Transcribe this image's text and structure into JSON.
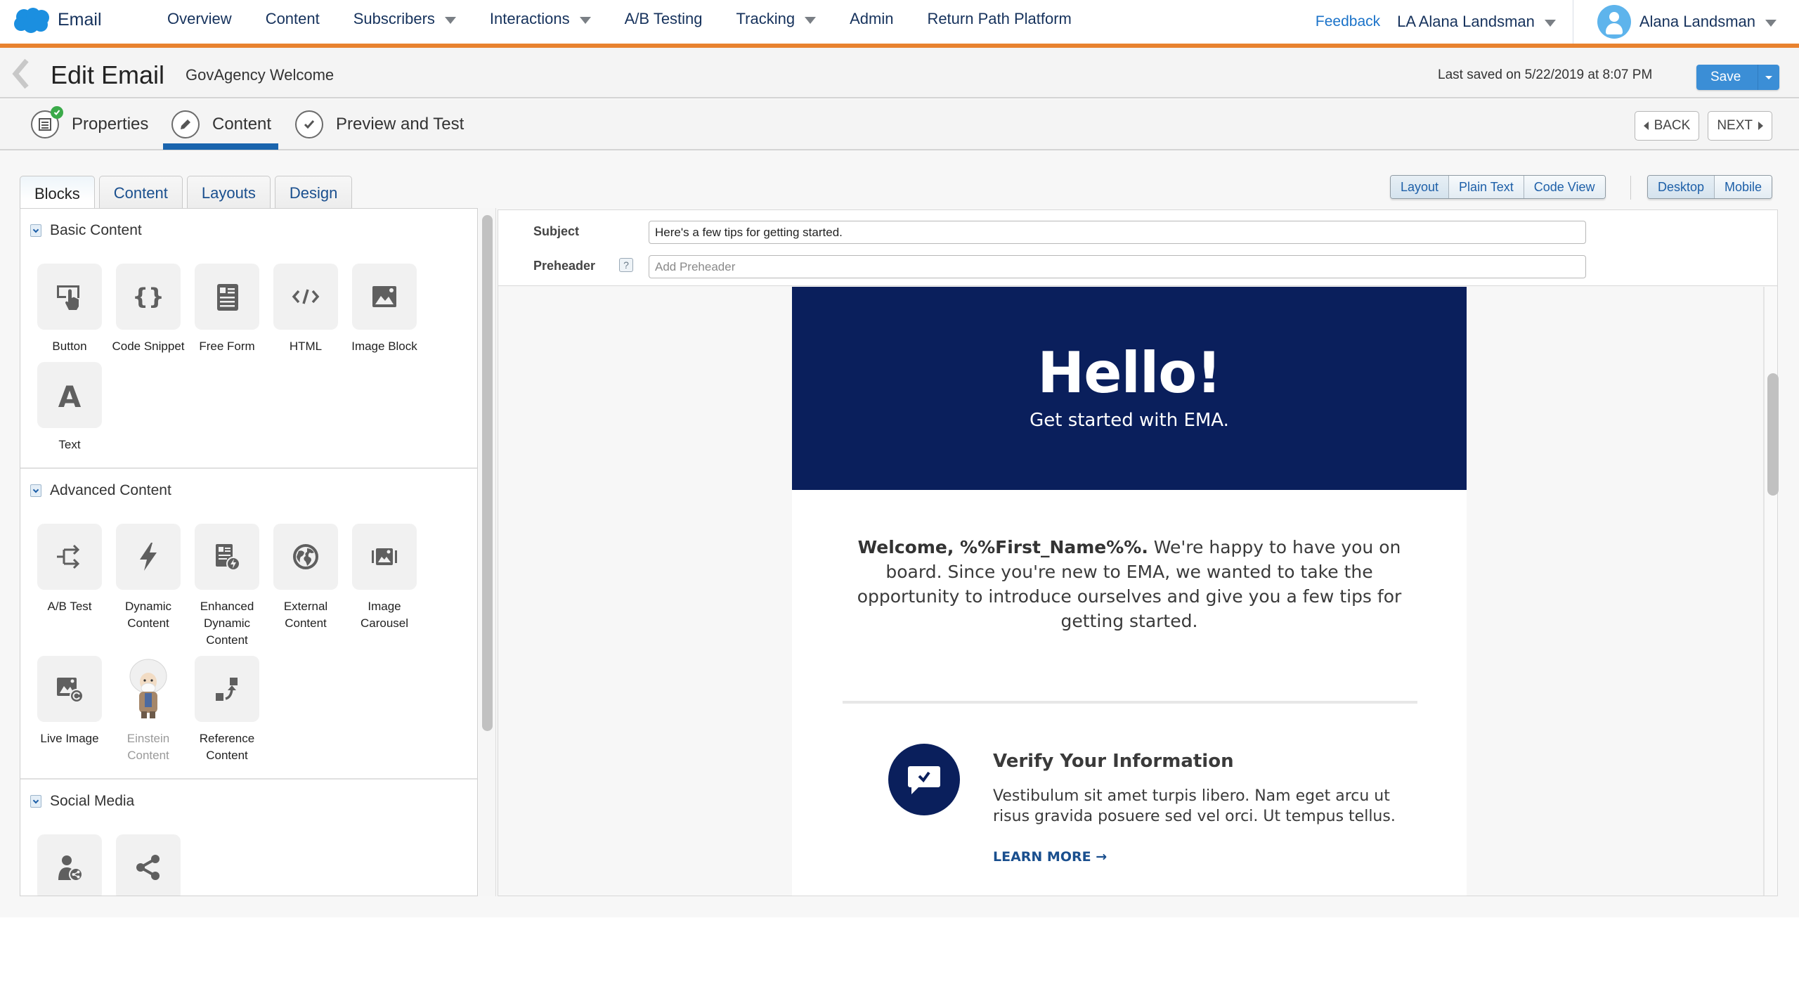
{
  "topnav": {
    "app_name": "Email",
    "links": [
      {
        "label": "Overview",
        "has_caret": false
      },
      {
        "label": "Content",
        "has_caret": false
      },
      {
        "label": "Subscribers",
        "has_caret": true
      },
      {
        "label": "Interactions",
        "has_caret": true
      },
      {
        "label": "A/B Testing",
        "has_caret": false
      },
      {
        "label": "Tracking",
        "has_caret": true
      },
      {
        "label": "Admin",
        "has_caret": false
      },
      {
        "label": "Return Path Platform",
        "has_caret": false
      }
    ],
    "feedback": "Feedback",
    "account_switcher": "LA Alana Landsman",
    "user_name": "Alana Landsman",
    "accent_color": "#e8822f",
    "logo_color": "#1b8fe0"
  },
  "header": {
    "title": "Edit Email",
    "email_name": "GovAgency Welcome",
    "last_saved": "Last saved on 5/22/2019 at 8:07 PM",
    "save_label": "Save"
  },
  "steps": {
    "items": [
      {
        "label": "Properties",
        "icon": "properties-icon",
        "completed": true
      },
      {
        "label": "Content",
        "icon": "pencil-icon",
        "active": true
      },
      {
        "label": "Preview and Test",
        "icon": "checkmark-icon"
      }
    ],
    "back_label": "BACK",
    "next_label": "NEXT"
  },
  "panel_tabs": [
    {
      "label": "Blocks",
      "active": true
    },
    {
      "label": "Content"
    },
    {
      "label": "Layouts"
    },
    {
      "label": "Design"
    }
  ],
  "sections": [
    {
      "title": "Basic Content",
      "blocks": [
        {
          "label": "Button",
          "icon": "button-icon"
        },
        {
          "label": "Code Snippet",
          "icon": "code-snippet-icon"
        },
        {
          "label": "Free Form",
          "icon": "free-form-icon"
        },
        {
          "label": "HTML",
          "icon": "html-icon"
        },
        {
          "label": "Image Block",
          "icon": "image-icon"
        },
        {
          "label": "Text",
          "icon": "text-icon"
        }
      ]
    },
    {
      "title": "Advanced Content",
      "blocks": [
        {
          "label": "A/B Test",
          "icon": "ab-test-icon"
        },
        {
          "label": "Dynamic Content",
          "icon": "lightning-icon"
        },
        {
          "label": "Enhanced Dynamic Content",
          "icon": "enhanced-dynamic-icon"
        },
        {
          "label": "External Content",
          "icon": "globe-icon"
        },
        {
          "label": "Image Carousel",
          "icon": "carousel-icon"
        },
        {
          "label": "Live Image",
          "icon": "live-image-icon"
        },
        {
          "label": "Einstein Content",
          "icon": "einstein-icon",
          "disabled": true
        },
        {
          "label": "Reference Content",
          "icon": "reference-icon"
        }
      ]
    },
    {
      "title": "Social Media",
      "blocks": [
        {
          "label": "Social Follow",
          "icon": "social-follow-icon"
        },
        {
          "label": "Social Share",
          "icon": "share-icon"
        }
      ]
    }
  ],
  "view_modes": [
    {
      "label": "Layout",
      "active": true
    },
    {
      "label": "Plain Text"
    },
    {
      "label": "Code View"
    }
  ],
  "devices": [
    {
      "label": "Desktop",
      "active": true
    },
    {
      "label": "Mobile"
    }
  ],
  "meta": {
    "subject_label": "Subject",
    "subject_value": "Here's a few tips for getting started.",
    "preheader_label": "Preheader",
    "preheader_placeholder": "Add Preheader",
    "help": "?"
  },
  "email": {
    "hero_title": "Hello!",
    "hero_subtitle": "Get started with EMA.",
    "hero_color": "#0a1f5c",
    "intro_bold": "Welcome, %%First_Name%%.",
    "intro_text": " We're happy to have you on board. Since you're new to EMA, we wanted to take the opportunity to introduce ourselves and give you a few tips for getting started.",
    "feature_title": "Verify Your Information",
    "feature_body": "Vestibulum sit amet turpis libero. Nam eget arcu ut risus gravida posuere sed vel orci. Ut tempus tellus.",
    "feature_link": "LEARN MORE →"
  }
}
